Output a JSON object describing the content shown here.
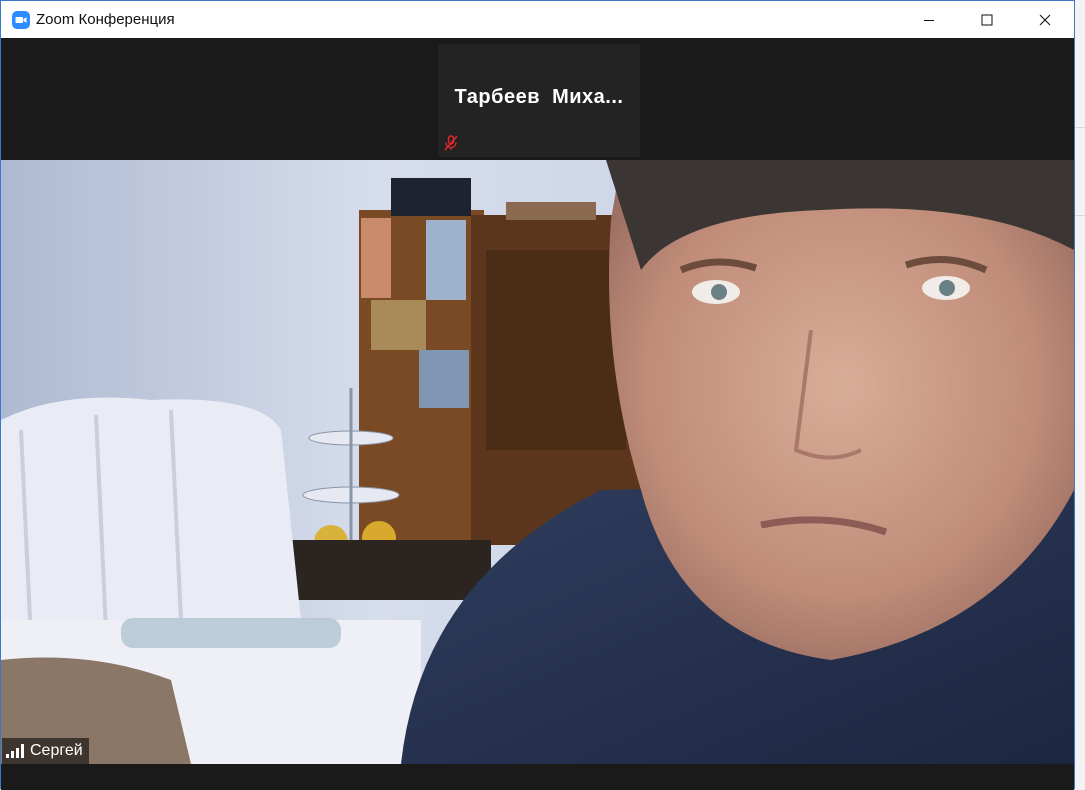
{
  "window": {
    "title": "Zoom Конференция"
  },
  "icons": {
    "app": "zoom-logo-icon",
    "minimize": "minimize-icon",
    "maximize": "maximize-icon",
    "close": "close-icon",
    "mute": "microphone-muted-icon",
    "signal": "signal-strength-icon"
  },
  "thumbnail": {
    "participant_name": "Тарбеев  Миха...",
    "muted": true
  },
  "main_video": {
    "speaker_name": "Сергей"
  },
  "colors": {
    "zoom_blue": "#2d8cff",
    "mute_red": "#e02828",
    "title_bg": "#ffffff",
    "video_bg": "#1a1a1a"
  }
}
